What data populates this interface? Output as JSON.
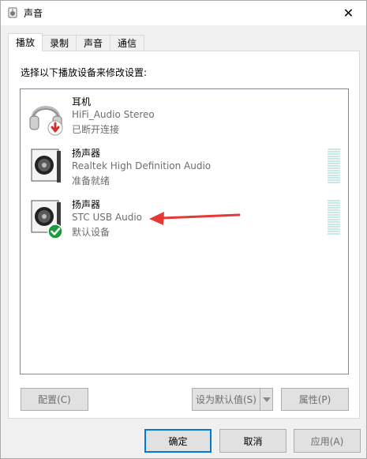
{
  "window": {
    "title": "声音",
    "close_glyph": "✕"
  },
  "tabs": [
    {
      "label": "播放",
      "active": true
    },
    {
      "label": "录制",
      "active": false
    },
    {
      "label": "声音",
      "active": false
    },
    {
      "label": "通信",
      "active": false
    }
  ],
  "panel": {
    "instruction": "选择以下播放设备来修改设置:",
    "devices": [
      {
        "name": "耳机",
        "description": "HiFi_Audio Stereo",
        "status": "已断开连接",
        "icon": "headphones-icon",
        "badge": "disconnected-badge-icon",
        "level_meter": false
      },
      {
        "name": "扬声器",
        "description": "Realtek High Definition Audio",
        "status": "准备就绪",
        "icon": "speaker-icon",
        "badge": null,
        "level_meter": true
      },
      {
        "name": "扬声器",
        "description": "STC USB Audio",
        "status": "默认设备",
        "icon": "speaker-icon",
        "badge": "default-check-badge-icon",
        "level_meter": true
      }
    ],
    "buttons": {
      "configure": "配置(C)",
      "set_default": "设为默认值(S)",
      "properties": "属性(P)"
    }
  },
  "footer": {
    "ok": "确定",
    "cancel": "取消",
    "apply": "应用(A)"
  },
  "colors": {
    "accent": "#0078d7",
    "arrow": "#e53935",
    "check_badge": "#1a9c3a",
    "disconnect_badge": "#d32f2f"
  }
}
